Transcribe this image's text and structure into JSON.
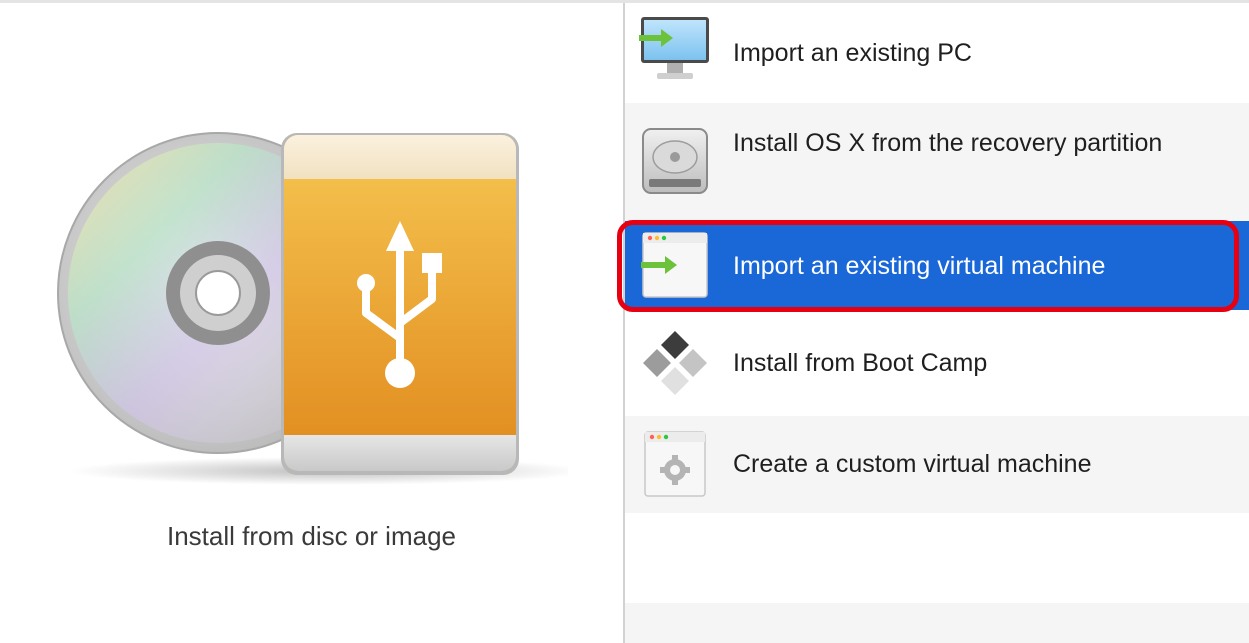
{
  "left": {
    "hero_label": "Install from disc or image",
    "hero_icon": "disc-and-usb-drive-icon"
  },
  "options": [
    {
      "label": "Import an existing PC",
      "icon": "monitor-import-icon",
      "selected": false
    },
    {
      "label": "Install OS X from the recovery partition",
      "icon": "hard-drive-icon",
      "selected": false
    },
    {
      "label": "Import an existing virtual machine",
      "icon": "window-import-icon",
      "selected": true
    },
    {
      "label": "Install from Boot Camp",
      "icon": "boot-camp-icon",
      "selected": false
    },
    {
      "label": "Create a custom virtual machine",
      "icon": "window-gear-icon",
      "selected": false
    }
  ],
  "colors": {
    "selection_blue": "#1a67d8",
    "annotation_red": "#e60012",
    "usb_orange": "#eda53a",
    "row_alt": "#f5f5f5"
  }
}
